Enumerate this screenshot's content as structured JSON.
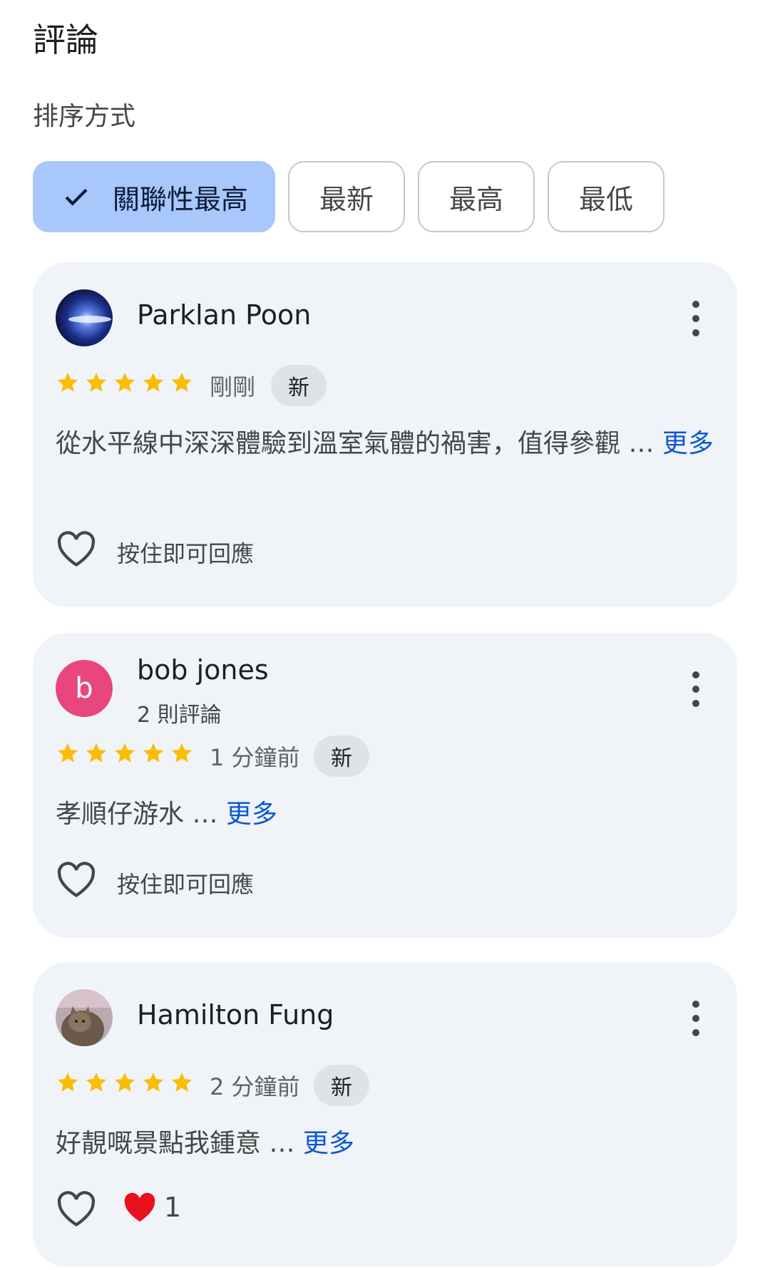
{
  "page": {
    "title": "評論",
    "sort_label": "排序方式"
  },
  "sort_chips": [
    {
      "label": "關聯性最高",
      "selected": true
    },
    {
      "label": "最新",
      "selected": false
    },
    {
      "label": "最高",
      "selected": false
    },
    {
      "label": "最低",
      "selected": false
    }
  ],
  "reviews": [
    {
      "author": "Parklan Poon",
      "subtitle": "",
      "rating": 5,
      "time": "剛剛",
      "badge": "新",
      "text": "從水平線中深深體驗到溫室氣體的禍害，值得參觀 … ",
      "more": "更多",
      "hold_hint": "按住即可回應",
      "reaction_count": ""
    },
    {
      "author": "bob jones",
      "avatar_letter": "b",
      "subtitle": "2 則評論",
      "rating": 5,
      "time": "1 分鐘前",
      "badge": "新",
      "text": "孝順仔游水 … ",
      "more": "更多",
      "hold_hint": "按住即可回應",
      "reaction_count": ""
    },
    {
      "author": "Hamilton Fung",
      "subtitle": "",
      "rating": 5,
      "time": "2 分鐘前",
      "badge": "新",
      "text": "好靚嘅景點我鍾意 … ",
      "more": "更多",
      "hold_hint": "",
      "reaction_count": "1"
    }
  ],
  "colors": {
    "accent": "#a8c7fa",
    "star": "#fbbc04",
    "link": "#0b57d0",
    "card": "#f0f4f8",
    "avatar_b": "#e8467c",
    "reaction_heart": "#e8101a"
  },
  "icons": {
    "check": "check-icon",
    "star": "star-icon",
    "menu": "more-vert-icon",
    "heart": "heart-outline-icon",
    "reaction": "red-heart-icon"
  }
}
